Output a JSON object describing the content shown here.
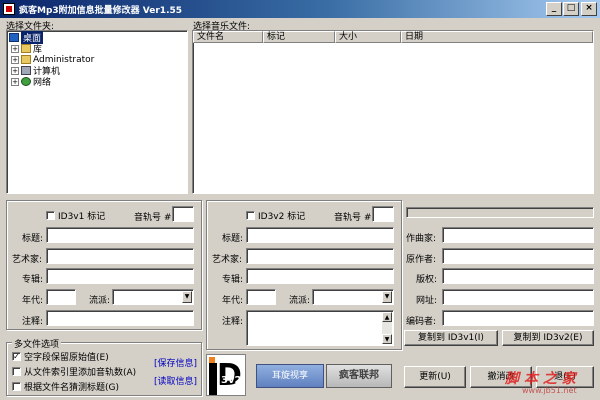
{
  "window": {
    "title": "疯客Mp3附加信息批量修改器 Ver1.55",
    "min": "_",
    "max": "□",
    "close": "×"
  },
  "folder_panel": {
    "label": "选择文件夹:",
    "items": [
      {
        "label": "桌面",
        "icon": "desktop-icon",
        "selected": true
      },
      {
        "label": "库",
        "icon": "folder-icon"
      },
      {
        "label": "Administrator",
        "icon": "folder-icon"
      },
      {
        "label": "计算机",
        "icon": "computer-icon"
      },
      {
        "label": "网络",
        "icon": "network-icon"
      }
    ]
  },
  "file_panel": {
    "label": "选择音乐文件:",
    "columns": [
      "文件名",
      "标记",
      "大小",
      "日期"
    ]
  },
  "id3v1": {
    "checkbox_label": "ID3v1 标记",
    "track_label": "音轨号 #:",
    "title_label": "标题:",
    "artist_label": "艺术家:",
    "album_label": "专辑:",
    "year_label": "年代:",
    "genre_label": "流派:",
    "comment_label": "注释:"
  },
  "id3v2": {
    "checkbox_label": "ID3v2 标记",
    "track_label": "音轨号 #:",
    "title_label": "标题:",
    "artist_label": "艺术家:",
    "album_label": "专辑:",
    "year_label": "年代:",
    "genre_label": "流派:",
    "comment_label": "注释:",
    "composer_label": "作曲家:",
    "orig_artist_label": "原作者:",
    "copyright_label": "版权:",
    "url_label": "网址:",
    "encoder_label": "编码者:",
    "copy_to_v1": "复制到 ID3v1(I)",
    "copy_to_v2": "复制到 ID3v2(E)"
  },
  "multi_options": {
    "title": "多文件选项",
    "opt1": "空字段保留原始值(E)",
    "opt2": "从文件索引里添加音轨数(A)",
    "opt3": "根据文件名猜测标题(G)",
    "save_info": "[保存信息]",
    "read_info": "[读取信息]"
  },
  "logo": {
    "id3v2_text": "3v2",
    "id_letter": "D"
  },
  "buttons": {
    "banner1": "耳旋视享",
    "banner2": "疯客联邦",
    "update": "更新(U)",
    "undo": "撤消改",
    "exit": "退(E)"
  },
  "watermark": {
    "text": "脚 本 之 家",
    "url": "www.jb51.net"
  }
}
